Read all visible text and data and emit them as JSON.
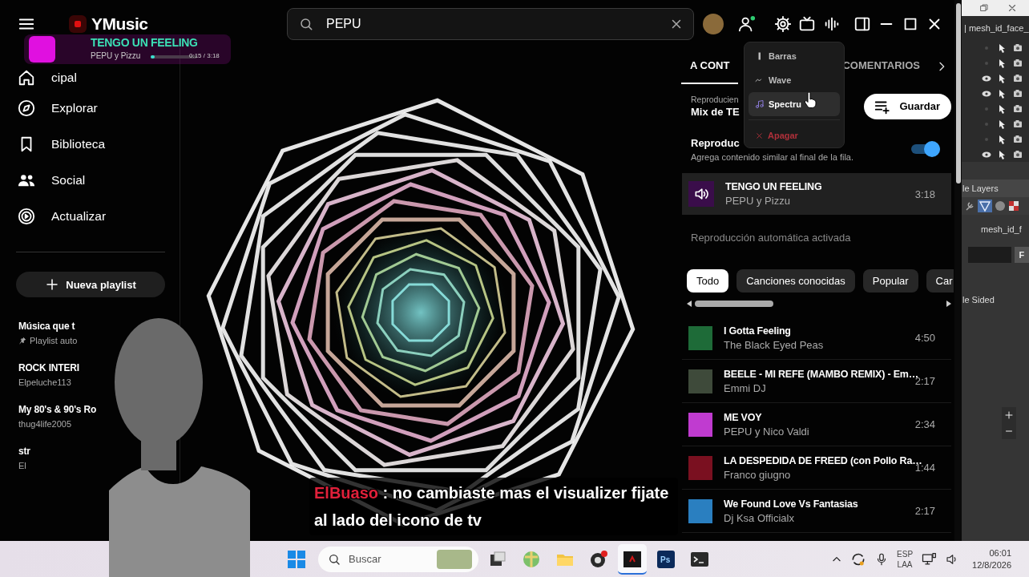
{
  "window": {
    "app_name": "YMusic"
  },
  "search": {
    "value": "PEPU"
  },
  "sidebar": {
    "items": [
      {
        "label": "cipal"
      },
      {
        "label": "Explorar"
      },
      {
        "label": "Biblioteca"
      },
      {
        "label": "Social"
      },
      {
        "label": "Actualizar"
      }
    ],
    "new_playlist": "Nueva playlist",
    "playlists": [
      {
        "title": "Música que t",
        "subtitle": "Playlist auto",
        "pinned": true
      },
      {
        "title": "ROCK INTERI",
        "subtitle": "Elpeluche113",
        "pinned": false
      },
      {
        "title": "My 80's & 90's Ro",
        "subtitle": "thug4life2005",
        "pinned": false
      },
      {
        "title": "str",
        "subtitle": "El",
        "pinned": false
      }
    ]
  },
  "mini_player": {
    "title": "TENGO UN FEELING",
    "artist": "PEPU y Pizzu",
    "time": "0:15 / 3:18",
    "level": 0.08
  },
  "visualizer_menu": {
    "items": [
      {
        "label": "Barras",
        "kind": "option",
        "selected": false
      },
      {
        "label": "Wave",
        "kind": "option",
        "selected": false
      },
      {
        "label": "Spectru",
        "kind": "option",
        "selected": true
      },
      {
        "label": "Apagar",
        "kind": "off",
        "selected": false
      }
    ]
  },
  "panel": {
    "tabs": [
      {
        "label": "A CONT",
        "selected": true
      },
      {
        "label": "COMENTARIOS",
        "selected": false
      }
    ],
    "playing_from": "Reproducien",
    "playlist_name": "Mix de TE",
    "save_button": "Guardar",
    "autoplay": {
      "title": "Reproduc",
      "description": "Agrega contenido similar al final de la fila.",
      "on": true
    },
    "now_playing": {
      "title": "TENGO UN FEELING",
      "artist": "PEPU y Pizzu",
      "duration": "3:18"
    },
    "autoplay_status": "Reproducción automática activada",
    "chips": [
      {
        "label": "Todo",
        "selected": true
      },
      {
        "label": "Canciones conocidas",
        "selected": false
      },
      {
        "label": "Popular",
        "selected": false
      },
      {
        "label": "Car",
        "selected": false
      }
    ],
    "queue": [
      {
        "title": "I Gotta Feeling",
        "artist": "The Black Eyed Peas",
        "duration": "4:50"
      },
      {
        "title": "BEELE - MI REFE (MAMBO REMIX) - Em…",
        "artist": "Emmi DJ",
        "duration": "2:17"
      },
      {
        "title": "ME VOY",
        "artist": "PEPU y Nico Valdi",
        "duration": "2:34"
      },
      {
        "title": "LA DESPEDIDA DE FREED (con Pollo Ra…",
        "artist": "Franco giugno",
        "duration": "1:44"
      },
      {
        "title": "We Found Love Vs Fantasias",
        "artist": "Dj Ksa Officialx",
        "duration": "2:17"
      }
    ]
  },
  "chat": {
    "author": "ElBuaso",
    "message": ": no cambiaste mas el visualizer fijate al lado del icono de tv"
  },
  "background_window": {
    "header": "| mesh_id_face_",
    "outliner_rows": [
      {
        "visible": false
      },
      {
        "visible": false
      },
      {
        "visible": true
      },
      {
        "visible": true
      },
      {
        "visible": false
      },
      {
        "visible": false
      },
      {
        "visible": false
      },
      {
        "visible": true
      }
    ],
    "layers": "le Layers",
    "object_name": "mesh_id_f",
    "field_button": "F",
    "option": "le Sided"
  },
  "taskbar": {
    "search_placeholder": "Buscar",
    "photoshop_label": "Ps",
    "language": "ESP",
    "layout": "LAA",
    "time": "06:01",
    "date": "12/8/2026"
  }
}
